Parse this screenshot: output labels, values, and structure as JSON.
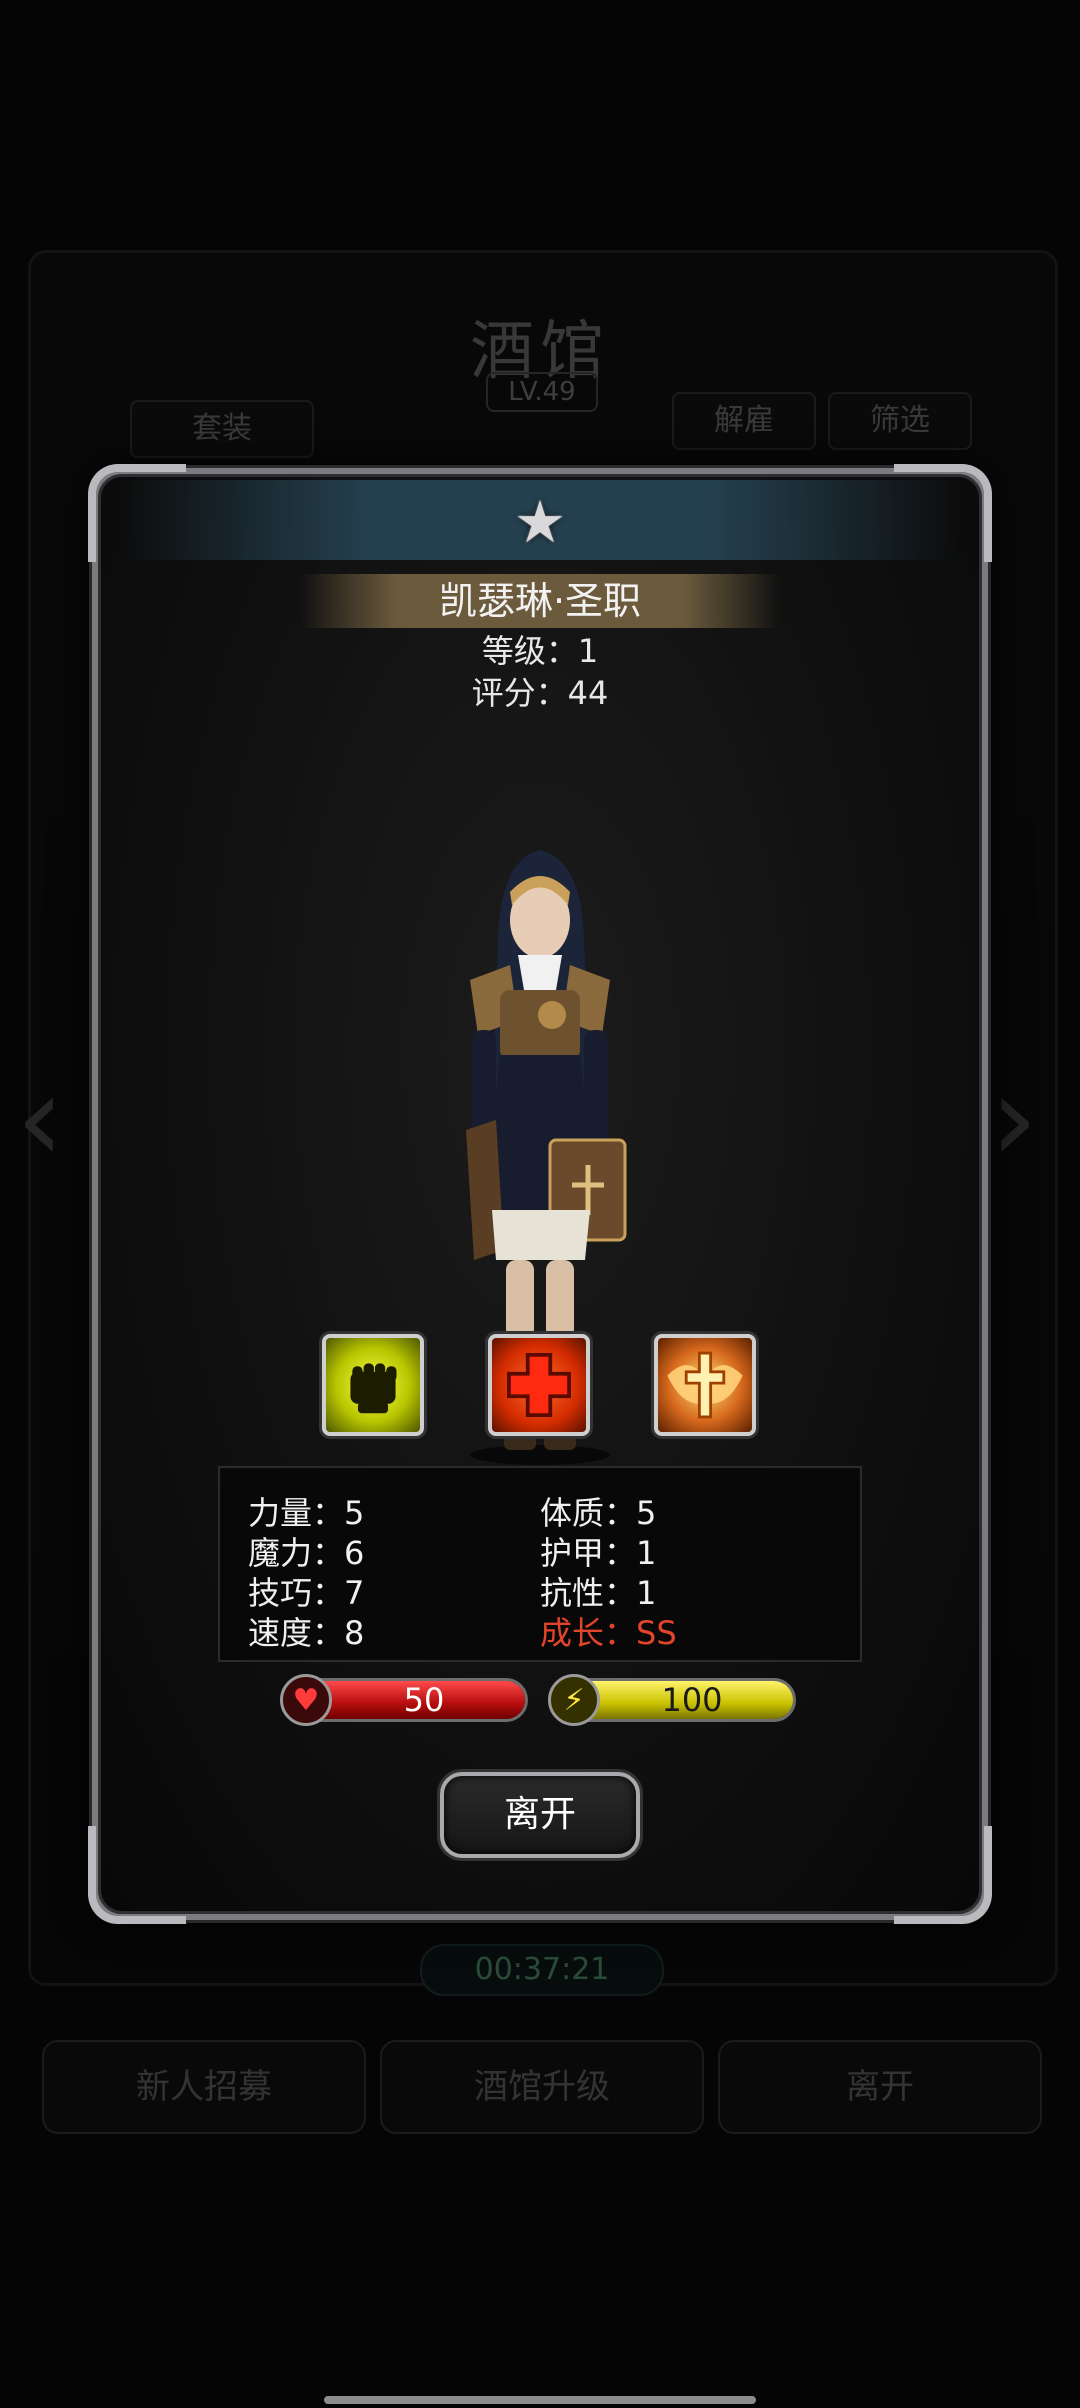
{
  "background": {
    "title": "酒馆",
    "level": "LV.49",
    "buttons": {
      "suit": "套装",
      "dismiss": "解雇",
      "filter": "筛选"
    },
    "timer": "00:37:21",
    "bottom_buttons": [
      "新人招募",
      "酒馆升级",
      "离开"
    ]
  },
  "hero": {
    "name": "凯瑟琳·圣职",
    "level": "等级：1",
    "score": "评分：44",
    "rank_icon": "star-icon"
  },
  "skills": [
    {
      "name": "fist-icon",
      "color": "#e8f000"
    },
    {
      "name": "cross-icon",
      "color": "#ff3c14"
    },
    {
      "name": "holy-cross-icon",
      "color": "#ff9a3c"
    }
  ],
  "stats": {
    "strength": "力量：5",
    "magic": "魔力：6",
    "skill": "技巧：7",
    "speed": "速度：8",
    "constitution": "体质：5",
    "armor": "护甲：1",
    "resistance": "抗性：1",
    "growth": "成长：SS"
  },
  "bars": {
    "hp": {
      "value": "50",
      "fill_fraction": 1.0,
      "icon": "heart-icon",
      "color": "#d81b1b"
    },
    "mp": {
      "value": "100",
      "fill_fraction": 1.0,
      "icon": "lightning-icon",
      "color": "#e0d400"
    }
  },
  "actions": {
    "leave": "离开"
  }
}
